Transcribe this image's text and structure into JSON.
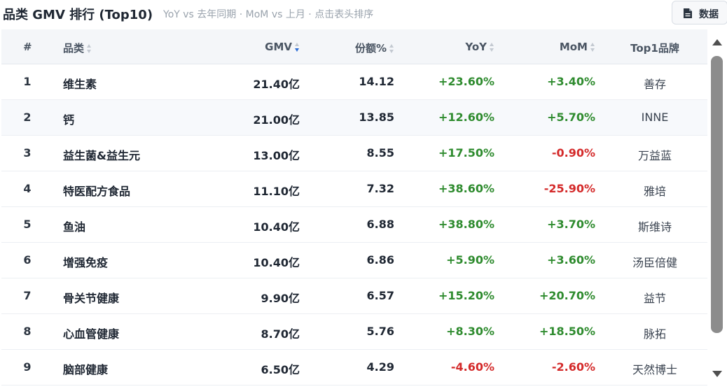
{
  "header": {
    "title": "品类 GMV 排行 (Top10)",
    "subtitle": "YoY vs 去年同期 · MoM vs 上月 · 点击表头排序",
    "data_button": {
      "label": "数据",
      "icon": "document-icon"
    }
  },
  "table": {
    "columns": {
      "rank": "#",
      "category": "品类",
      "gmv": "GMV",
      "share": "份额%",
      "yoy": "YoY",
      "mom": "MoM",
      "brand": "Top1品牌"
    },
    "sorted_by": "gmv",
    "sort_direction": "desc",
    "rows": [
      {
        "rank": "1",
        "category": "维生素",
        "gmv": "21.40亿",
        "share": "14.12",
        "yoy": "+23.60%",
        "mom": "+3.40%",
        "brand": "善存"
      },
      {
        "rank": "2",
        "category": "钙",
        "gmv": "21.00亿",
        "share": "13.85",
        "yoy": "+12.60%",
        "mom": "+5.70%",
        "brand": "INNE"
      },
      {
        "rank": "3",
        "category": "益生菌&益生元",
        "gmv": "13.00亿",
        "share": "8.55",
        "yoy": "+17.50%",
        "mom": "-0.90%",
        "brand": "万益蓝"
      },
      {
        "rank": "4",
        "category": "特医配方食品",
        "gmv": "11.10亿",
        "share": "7.32",
        "yoy": "+38.60%",
        "mom": "-25.90%",
        "brand": "雅培"
      },
      {
        "rank": "5",
        "category": "鱼油",
        "gmv": "10.40亿",
        "share": "6.88",
        "yoy": "+38.80%",
        "mom": "+3.70%",
        "brand": "斯维诗"
      },
      {
        "rank": "6",
        "category": "增强免疫",
        "gmv": "10.40亿",
        "share": "6.86",
        "yoy": "+5.90%",
        "mom": "+3.60%",
        "brand": "汤臣倍健"
      },
      {
        "rank": "7",
        "category": "骨关节健康",
        "gmv": "9.90亿",
        "share": "6.57",
        "yoy": "+15.20%",
        "mom": "+20.70%",
        "brand": "益节"
      },
      {
        "rank": "8",
        "category": "心血管健康",
        "gmv": "8.70亿",
        "share": "5.76",
        "yoy": "+8.30%",
        "mom": "+18.50%",
        "brand": "脉拓"
      },
      {
        "rank": "9",
        "category": "脑部健康",
        "gmv": "6.50亿",
        "share": "4.29",
        "yoy": "-4.60%",
        "mom": "-2.60%",
        "brand": "天然博士"
      }
    ]
  },
  "colors": {
    "positive": "#2e8b2e",
    "negative": "#d42a2a",
    "sort_active": "#2f6fd6"
  }
}
